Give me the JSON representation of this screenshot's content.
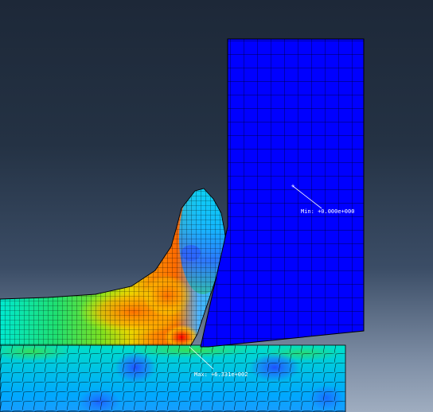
{
  "viewport": {
    "background_top": "#1d2838",
    "background_bottom": "#9fadc0"
  },
  "contour": {
    "colors": [
      "#0000ff",
      "#005cff",
      "#00b9ff",
      "#00ffe8",
      "#00ff8b",
      "#00ff2e",
      "#2eff00",
      "#8bff00",
      "#e8ff00",
      "#ffb900",
      "#ff5c00",
      "#ff0000"
    ],
    "mesh_line_color": "#000000"
  },
  "annotations": {
    "min_label": "Min: +0.000e+000",
    "max_label": "Max: +6.331e+002"
  },
  "parts": {
    "tool": "cutting tool (uniform low value, blue)",
    "chip": "deformed chip",
    "workpiece": "workpiece"
  }
}
